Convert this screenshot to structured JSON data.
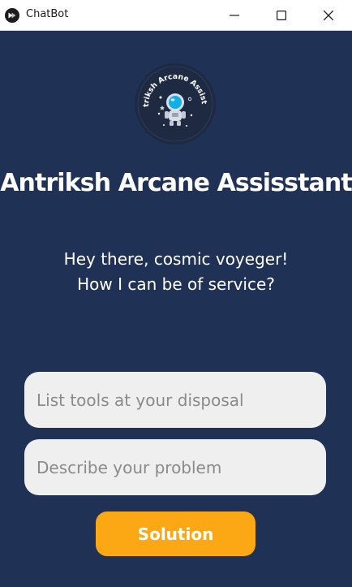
{
  "window": {
    "title": "ChatBot",
    "icons": {
      "app": "chat-bubble-icon",
      "minimize": "minimize-icon",
      "maximize": "maximize-icon",
      "close": "close-icon"
    }
  },
  "logo": {
    "text": "Antriksh Arcane Assistant",
    "icon": "astronaut-icon"
  },
  "heading": "Antriksh Arcane Assisstant",
  "greeting": {
    "line1": "Hey there, cosmic voyeger!",
    "line2": "How I can be of service?"
  },
  "form": {
    "tools_placeholder": "List tools at your disposal",
    "tools_value": "",
    "problem_placeholder": "Describe your problem",
    "problem_value": "",
    "submit_label": "Solution"
  },
  "colors": {
    "background": "#1f3256",
    "input": "#efefef",
    "button": "#fca714",
    "text": "#ffffff"
  }
}
